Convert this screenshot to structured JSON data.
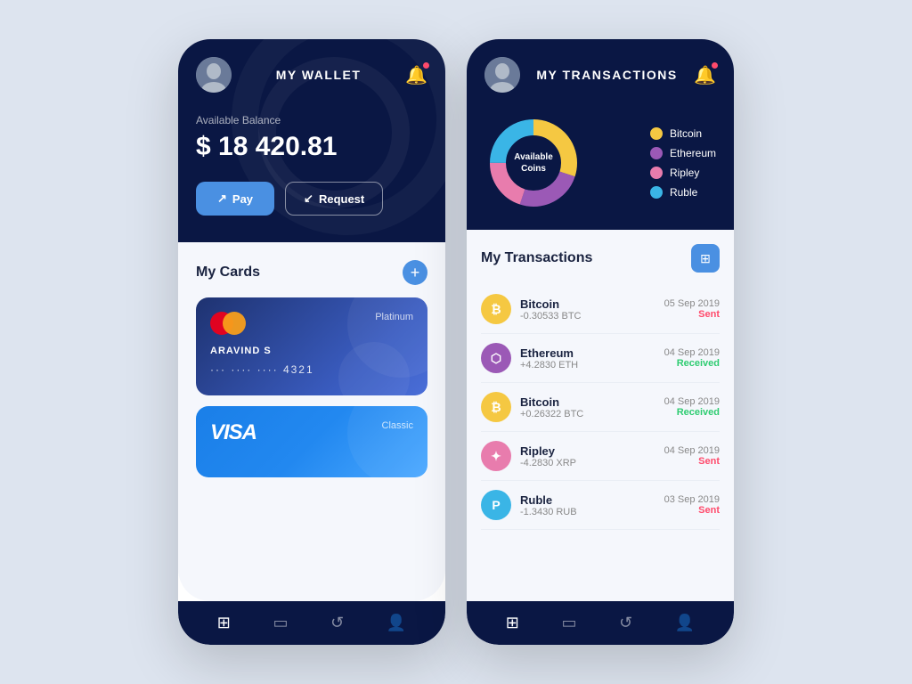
{
  "wallet": {
    "title": "MY WALLET",
    "balance_label": "Available Balance",
    "balance": "$ 18 420.81",
    "pay_label": "Pay",
    "request_label": "Request",
    "my_cards_label": "My Cards",
    "cards": [
      {
        "type": "Platinum",
        "brand": "mastercard",
        "holder": "ARAVIND S",
        "number": "···  ····  ····  4321"
      },
      {
        "type": "Classic",
        "brand": "visa",
        "holder": "",
        "number": ""
      }
    ],
    "nav_items": [
      "grid",
      "card",
      "history",
      "user"
    ]
  },
  "transactions": {
    "title": "MY TRANSACTIONS",
    "my_transactions_label": "My Transactions",
    "donut_center": "Available\nCoins",
    "legend": [
      {
        "label": "Bitcoin",
        "color": "#f5c842"
      },
      {
        "label": "Ethereum",
        "color": "#9b59b6"
      },
      {
        "label": "Ripley",
        "color": "#e87cad"
      },
      {
        "label": "Ruble",
        "color": "#3ab5e6"
      }
    ],
    "donut_segments": [
      {
        "label": "Bitcoin",
        "value": 30,
        "color": "#f5c842",
        "offset": 0
      },
      {
        "label": "Ethereum",
        "value": 25,
        "color": "#9b59b6",
        "offset": 30
      },
      {
        "label": "Ripley",
        "value": 20,
        "color": "#e87cad",
        "offset": 55
      },
      {
        "label": "Ruble",
        "value": 25,
        "color": "#3ab5e6",
        "offset": 75
      }
    ],
    "items": [
      {
        "name": "Bitcoin",
        "amount": "-0.30533 BTC",
        "date": "05 Sep 2019",
        "status": "Sent",
        "type": "sent",
        "icon_bg": "#f5c842",
        "icon_text": "₿",
        "icon_color": "#fff"
      },
      {
        "name": "Ethereum",
        "amount": "+4.2830 ETH",
        "date": "04 Sep 2019",
        "status": "Received",
        "type": "received",
        "icon_bg": "#9b59b6",
        "icon_text": "⬦",
        "icon_color": "#fff"
      },
      {
        "name": "Bitcoin",
        "amount": "+0.26322 BTC",
        "date": "04 Sep 2019",
        "status": "Received",
        "type": "received",
        "icon_bg": "#f5c842",
        "icon_text": "₿",
        "icon_color": "#fff"
      },
      {
        "name": "Ripley",
        "amount": "-4.2830 XRP",
        "date": "04 Sep 2019",
        "status": "Sent",
        "type": "sent",
        "icon_bg": "#e87cad",
        "icon_text": "✦",
        "icon_color": "#fff"
      },
      {
        "name": "Ruble",
        "amount": "-1.3430 RUB",
        "date": "03 Sep 2019",
        "status": "Sent",
        "type": "sent",
        "icon_bg": "#3ab5e6",
        "icon_text": "P",
        "icon_color": "#fff"
      }
    ],
    "nav_items": [
      "grid",
      "card",
      "history",
      "user"
    ]
  }
}
